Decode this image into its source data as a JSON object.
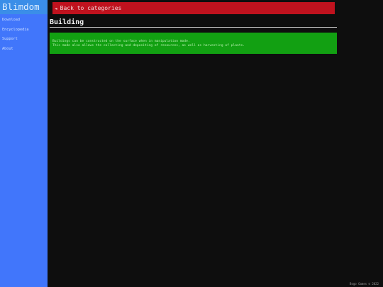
{
  "sidebar": {
    "brand": "Blimdom",
    "items": [
      {
        "label": "Download"
      },
      {
        "label": "Encyclopedia"
      },
      {
        "label": "Support"
      },
      {
        "label": "About"
      }
    ]
  },
  "main": {
    "back_label": "Back to categories",
    "back_icon": "left-triangle-icon",
    "title": "Building",
    "description_lines": [
      "Buildings can be constructed on the surface when in manipulation mode.",
      "This mode also allows the collecting and depositing of resources, as well as harvesting of plants."
    ]
  },
  "footer": {
    "text": "Bogo Games © 2022"
  },
  "colors": {
    "sidebar": "#4176fb",
    "brand_bg": "#3b8ee8",
    "back_button": "#c0121e",
    "info_box": "#12a012",
    "background": "#0e0e0e"
  }
}
